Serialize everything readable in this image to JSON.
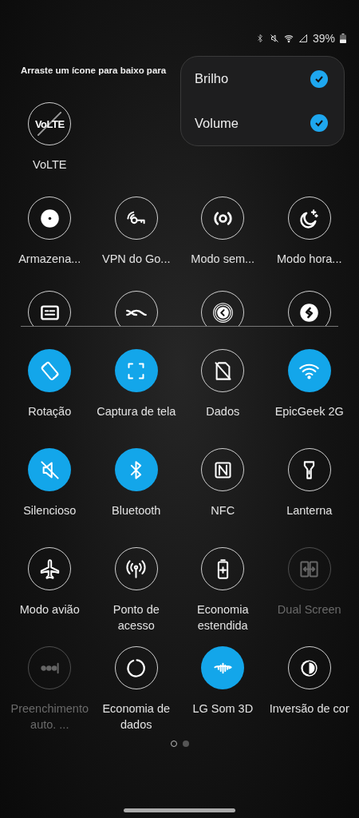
{
  "status_bar": {
    "battery": "39%"
  },
  "hint": "Arraste um ícone para baixo para",
  "menu": {
    "items": [
      {
        "label": "Brilho",
        "checked": true
      },
      {
        "label": "Volume",
        "checked": true
      }
    ]
  },
  "available_rows": [
    {
      "cut_off": false,
      "tiles": [
        {
          "kind": "labeled",
          "label": "VoLTE",
          "icon_text": "VoLTE"
        }
      ]
    },
    {
      "cut_off": false,
      "tiles": [
        {
          "kind": "labeled",
          "label": "Armazena..."
        },
        {
          "kind": "labeled",
          "label": "VPN do Go..."
        },
        {
          "kind": "labeled",
          "label": "Modo sem..."
        },
        {
          "kind": "labeled",
          "label": "Modo hora..."
        }
      ]
    },
    {
      "cut_off": true,
      "tiles": [
        {
          "kind": "icon"
        },
        {
          "kind": "icon"
        },
        {
          "kind": "icon"
        },
        {
          "kind": "icon"
        }
      ]
    }
  ],
  "active_tiles": [
    {
      "label": "Rotação",
      "on": true,
      "disabled": false
    },
    {
      "label": "Captura de tela",
      "on": true,
      "disabled": false
    },
    {
      "label": "Dados",
      "on": false,
      "disabled": false
    },
    {
      "label": "EpicGeek 2G",
      "on": true,
      "disabled": false
    },
    {
      "label": "Silencioso",
      "on": true,
      "disabled": false
    },
    {
      "label": "Bluetooth",
      "on": true,
      "disabled": false
    },
    {
      "label": "NFC",
      "on": false,
      "disabled": false
    },
    {
      "label": "Lanterna",
      "on": false,
      "disabled": false
    },
    {
      "label": "Modo avião",
      "on": false,
      "disabled": false
    },
    {
      "label": "Ponto de acesso",
      "on": false,
      "disabled": false
    },
    {
      "label": "Economia estendida",
      "on": false,
      "disabled": false
    },
    {
      "label": "Dual Screen",
      "on": false,
      "disabled": true
    },
    {
      "label": "Preenchimento auto. ...",
      "on": false,
      "disabled": true
    },
    {
      "label": "Economia de dados",
      "on": false,
      "disabled": false
    },
    {
      "label": "LG Som 3D",
      "on": true,
      "disabled": false
    },
    {
      "label": "Inversão de cor",
      "on": false,
      "disabled": false
    }
  ],
  "page_indicator": [
    {
      "selected": true
    },
    {
      "selected": false
    }
  ]
}
